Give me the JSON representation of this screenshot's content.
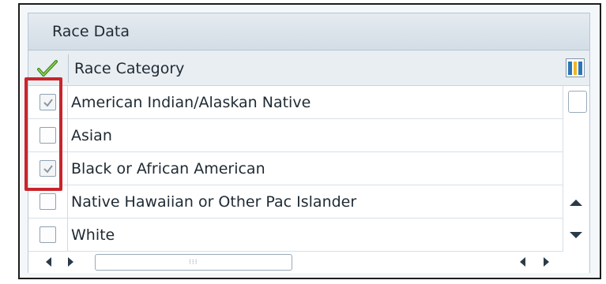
{
  "panel": {
    "title": "Race Data"
  },
  "table": {
    "header": "Race Category",
    "rows": [
      {
        "label": "American Indian/Alaskan Native",
        "checked": true
      },
      {
        "label": "Asian",
        "checked": false
      },
      {
        "label": "Black or African American",
        "checked": true
      },
      {
        "label": "Native Hawaiian or Other Pac Islander",
        "checked": false
      },
      {
        "label": "White",
        "checked": false
      }
    ]
  },
  "colors": {
    "highlight": "#c9252c",
    "accent": "#2c75b8",
    "checkmark_header": "#3f8a1e"
  },
  "icons": {
    "select_all": "green-checkmark-icon",
    "layout": "column-layout-icon",
    "scroll_up": "triangle-up-icon",
    "scroll_down": "triangle-down-icon",
    "scroll_left": "triangle-left-icon",
    "scroll_right": "triangle-right-icon",
    "grip": "grip-dots-icon"
  }
}
